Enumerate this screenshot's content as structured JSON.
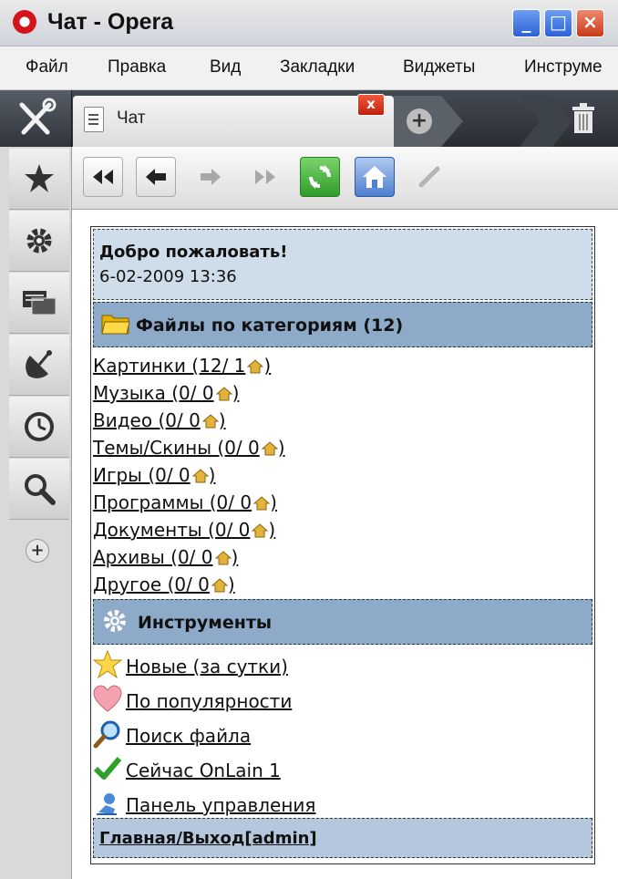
{
  "window": {
    "title": "Чат - Opera",
    "min": "_",
    "max": "□",
    "close": "×"
  },
  "menu": [
    "Файл",
    "Правка",
    "Вид",
    "Закладки",
    "Виджеты",
    "Инструме"
  ],
  "tab": {
    "label": "Чат",
    "close": "x",
    "new": "+"
  },
  "sidebar_add": "+",
  "welcome": {
    "heading": "Добро пожаловать!",
    "datetime": "6-02-2009 13:36"
  },
  "files": {
    "title": "Файлы по категориям (12)",
    "items": [
      {
        "label": "Картинки (12/ 1",
        "tail": ")"
      },
      {
        "label": "Музыка (0/ 0",
        "tail": ")"
      },
      {
        "label": "Видео (0/ 0",
        "tail": ")"
      },
      {
        "label": "Темы/Скины (0/ 0",
        "tail": ")"
      },
      {
        "label": "Игры (0/ 0",
        "tail": ")"
      },
      {
        "label": "Программы (0/ 0",
        "tail": ")"
      },
      {
        "label": "Документы (0/ 0",
        "tail": ")"
      },
      {
        "label": "Архивы (0/ 0",
        "tail": ")"
      },
      {
        "label": "Другое (0/ 0",
        "tail": ")"
      }
    ]
  },
  "tools": {
    "title": "Инструменты",
    "items": [
      "Новые (за сутки)",
      "По популярности",
      "Поиск файла",
      "Сейчас OnLain 1",
      "Панель управления"
    ]
  },
  "footer": {
    "home": "Главная",
    "sep": "/",
    "logout": "Выход[admin]"
  },
  "colors": {
    "section": "#8eaac9",
    "welcome": "#cfdcea",
    "footer": "#b4c7dc"
  }
}
